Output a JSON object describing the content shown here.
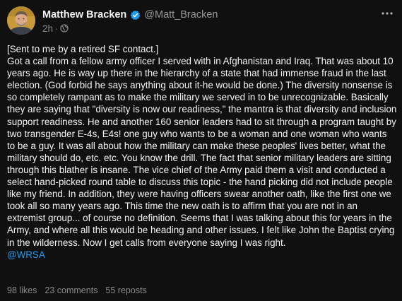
{
  "author": {
    "display_name": "Matthew Bracken",
    "handle": "@Matt_Bracken",
    "verified": true,
    "avatar_icon": "avatar-photo"
  },
  "post": {
    "timestamp": "2h",
    "visibility_icon": "globe-icon",
    "paragraphs": [
      "[Sent to me by a retired SF contact.]",
      "Got a call from a fellow army officer I served with in Afghanistan and Iraq. That was about 10 years ago. He is way up there in the hierarchy of a state that had immense fraud in the last election. (God forbid he says anything about it-he would be done.) The diversity nonsense is so completely rampant as to make the military we served in to be unrecognizable. Basically they are saying that \"diversity is now our readiness,\" the mantra is that diversity and inclusion support readiness. He and another 160 senior leaders had to sit through a program taught by two transgender E-4s, E4s! one guy who wants to be a woman and one woman who wants to be a guy. It was all about how the military can make these peoples' lives better, what the military should do, etc. etc. You know the drill. The fact that senior military leaders are sitting through this blather is insane. The vice chief of the Army paid them a visit and conducted a select hand-picked round table to discuss this topic - the hand picking did not include people like my friend. In addition, they were having officers swear another oath, like the first one we took all so many years ago. This time the new oath is to affirm that you are not in an extremist group... of course no definition. Seems that I was talking about this for years in the Army, and where all this would be heading and other issues. I felt like John the Baptist crying in the wilderness. Now I get calls from everyone saying I was right."
    ],
    "mention": "@WRSA"
  },
  "stats": {
    "likes": "98 likes",
    "comments": "23 comments",
    "reposts": "55 reposts"
  },
  "colors": {
    "background": "#101010",
    "text": "#f3f5f7",
    "secondary": "#8a8a8a",
    "link": "#1d9bf0",
    "verified": "#1d9bf0"
  },
  "icons": [
    "verified-badge-icon",
    "globe-icon",
    "more-options-icon"
  ]
}
